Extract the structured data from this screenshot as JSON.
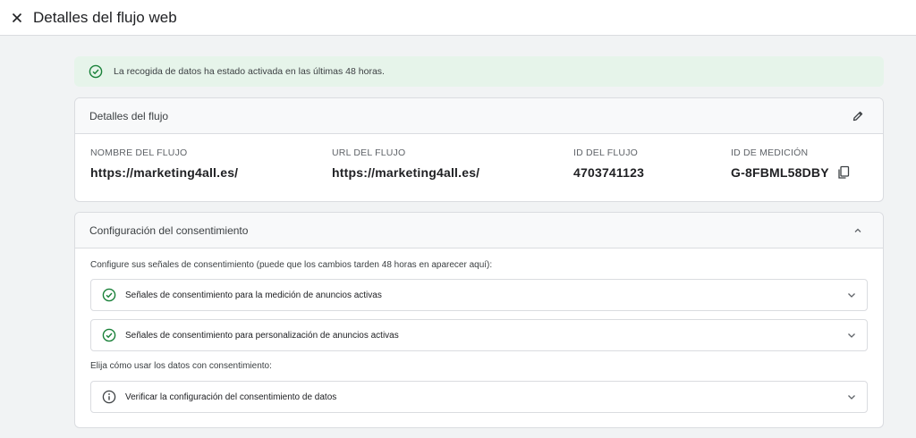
{
  "header": {
    "title": "Detalles del flujo web"
  },
  "banner": {
    "text": "La recogida de datos ha estado activada en las últimas 48 horas."
  },
  "details": {
    "title": "Detalles del flujo",
    "fields": [
      {
        "label": "NOMBRE DEL FLUJO",
        "value": "https://marketing4all.es/"
      },
      {
        "label": "URL DEL FLUJO",
        "value": "https://marketing4all.es/"
      },
      {
        "label": "ID DEL FLUJO",
        "value": "4703741123"
      },
      {
        "label": "ID DE MEDICIÓN",
        "value": "G-8FBML58DBY"
      }
    ]
  },
  "consent": {
    "title": "Configuración del consentimiento",
    "intro": "Configure sus señales de consentimiento (puede que los cambios tarden 48 horas en aparecer aquí):",
    "rows": [
      {
        "label": "Señales de consentimiento para la medición de anuncios activas",
        "icon": "check-circle-icon"
      },
      {
        "label": "Señales de consentimiento para personalización de anuncios activas",
        "icon": "check-circle-icon"
      }
    ],
    "choice_label": "Elija cómo usar los datos con consentimiento:",
    "verify": {
      "label": "Verificar la configuración del consentimiento de datos",
      "icon": "info-icon"
    }
  },
  "colors": {
    "success": "#188038",
    "banner_bg": "#e6f4ea",
    "border": "#dadce0",
    "page_bg": "#f1f3f4"
  }
}
